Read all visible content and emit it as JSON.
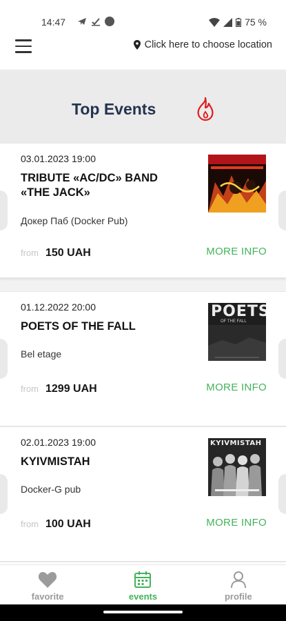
{
  "status_bar": {
    "time": "14:47",
    "battery": "75 %"
  },
  "header": {
    "location_label": "Click here to choose location"
  },
  "banner": {
    "title": "Top Events"
  },
  "events": [
    {
      "date": "03.01.2023 19:00",
      "title": "TRIBUTE «AC/DC» BAND «THE JACK»",
      "venue": "Докер Паб (Docker Pub)",
      "price_from": "from",
      "price": "150 UAH",
      "more_info": "MORE INFO"
    },
    {
      "date": "01.12.2022 20:00",
      "title": "POETS OF THE FALL",
      "venue": "Bel etage",
      "price_from": "from",
      "price": "1299 UAH",
      "more_info": "MORE INFO",
      "poster_text": "POETS",
      "poster_subtext": "OF THE FALL"
    },
    {
      "date": "02.01.2023 19:00",
      "title": "KYIVMISTAH",
      "venue": "Docker-G pub",
      "price_from": "from",
      "price": "100 UAH",
      "more_info": "MORE INFO",
      "poster_text": "KYIVMISTAH"
    }
  ],
  "nav": {
    "favorite": "favorite",
    "events": "events",
    "profile": "profile"
  },
  "colors": {
    "accent": "#43b25a",
    "title": "#24344f",
    "fire": "#e01b1b"
  }
}
